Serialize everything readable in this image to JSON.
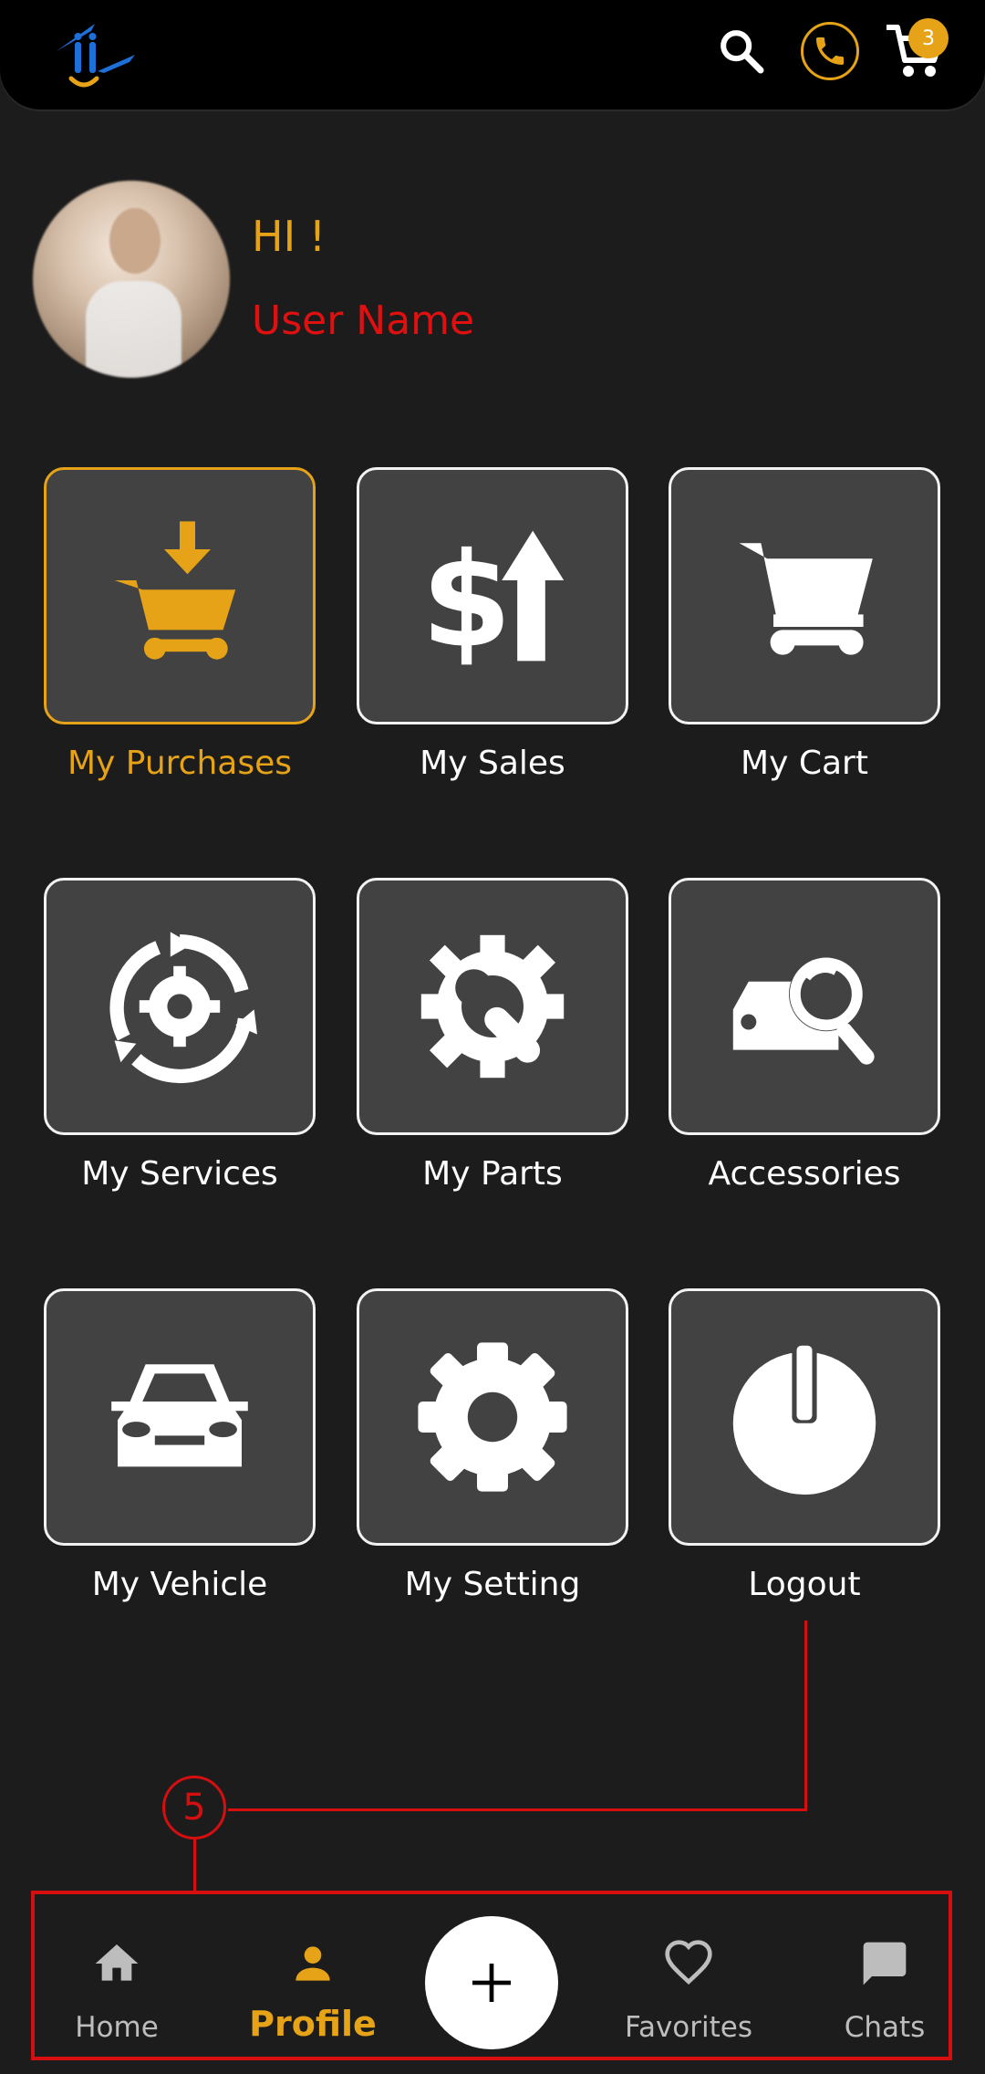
{
  "header": {
    "cart_count": "3",
    "accent_color": "#e6a317"
  },
  "profile": {
    "greeting": "HI !",
    "user_name": "User Name"
  },
  "tiles": [
    {
      "label": "My Purchases",
      "icon": "cart-download-icon",
      "active": true
    },
    {
      "label": "My Sales",
      "icon": "dollar-up-icon"
    },
    {
      "label": "My Cart",
      "icon": "cart-icon"
    },
    {
      "label": "My Services",
      "icon": "gear-cycle-icon"
    },
    {
      "label": "My Parts",
      "icon": "gear-wrench-icon"
    },
    {
      "label": "Accessories",
      "icon": "car-search-icon"
    },
    {
      "label": "My Vehicle",
      "icon": "car-icon"
    },
    {
      "label": "My Setting",
      "icon": "gear-icon"
    },
    {
      "label": "Logout",
      "icon": "power-icon"
    }
  ],
  "annotation": {
    "number": "5",
    "color": "#d50f0f"
  },
  "bottom_nav": {
    "items": [
      {
        "label": "Home",
        "icon": "home-icon"
      },
      {
        "label": "Profile",
        "icon": "person-icon",
        "active": true
      },
      {
        "label": "Favorites",
        "icon": "heart-icon"
      },
      {
        "label": "Chats",
        "icon": "chat-icon"
      }
    ],
    "fab_icon": "plus-icon"
  }
}
